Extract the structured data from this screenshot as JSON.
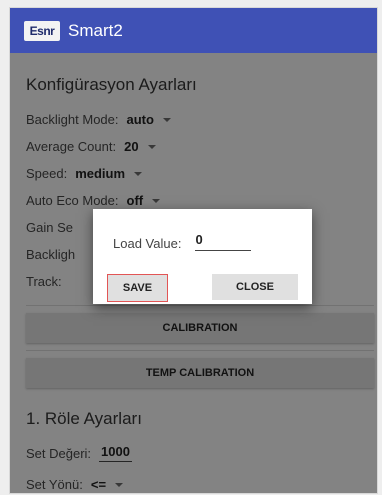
{
  "app": {
    "logo_text": "Esnr",
    "title": "Smart2"
  },
  "config": {
    "title": "Konfigürasyon Ayarları",
    "backlight_mode": {
      "label": "Backlight Mode:",
      "value": "auto"
    },
    "average_count": {
      "label": "Average Count:",
      "value": "20"
    },
    "speed": {
      "label": "Speed:",
      "value": "medium"
    },
    "auto_eco_mode": {
      "label": "Auto Eco Mode:",
      "value": "off"
    },
    "gain_label": "Gain Se",
    "backlight_label": "Backligh",
    "track_label": "Track:",
    "calibration_button": "CALIBRATION",
    "temp_calibration_button": "TEMP CALIBRATION"
  },
  "relay1": {
    "title": "1. Röle Ayarları",
    "set_value": {
      "label": "Set Değeri:",
      "value": "1000"
    },
    "set_direction": {
      "label": "Set Yönü:",
      "value": "<="
    }
  },
  "dialog": {
    "label": "Load Value:",
    "value": "0",
    "save_label": "SAVE",
    "close_label": "CLOSE"
  }
}
